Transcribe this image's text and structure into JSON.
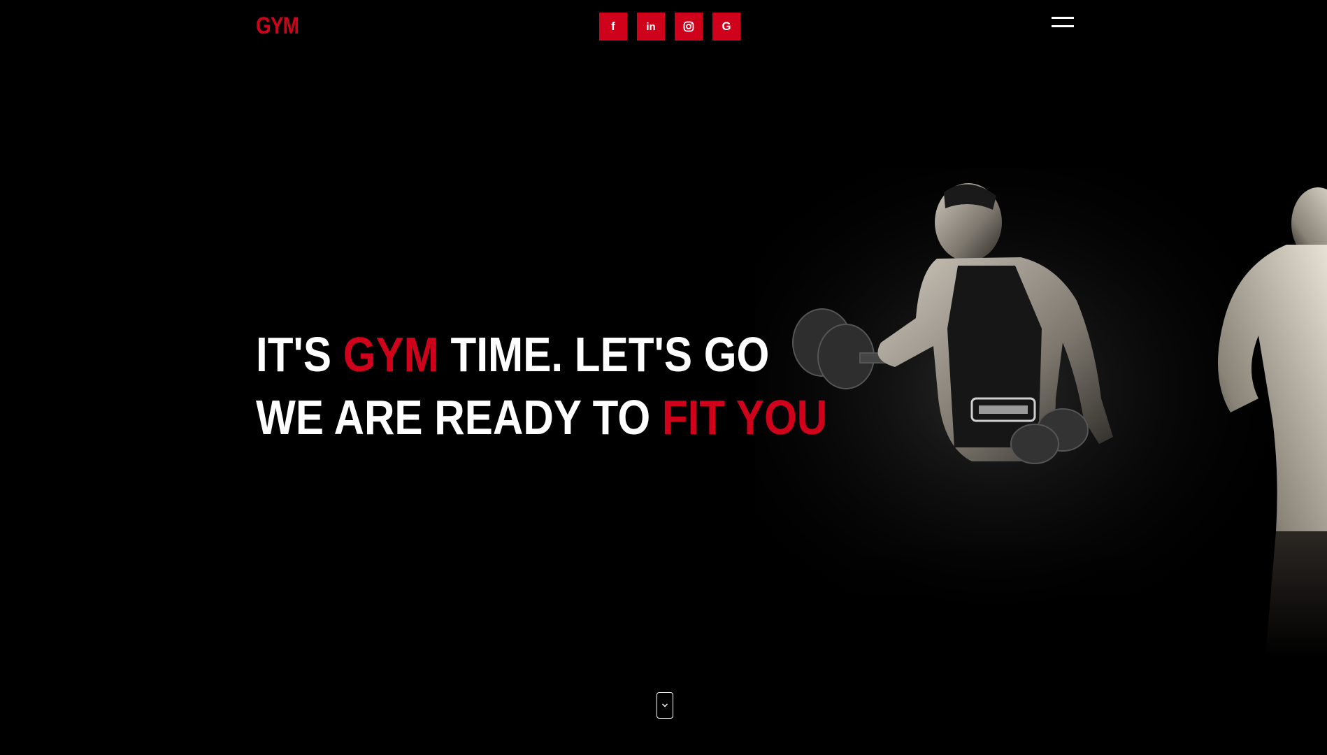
{
  "brand": {
    "logo_text": "GYM"
  },
  "social": [
    {
      "name": "facebook",
      "icon": "facebook-icon",
      "label": "f"
    },
    {
      "name": "linkedin",
      "icon": "linkedin-icon",
      "label": "in"
    },
    {
      "name": "instagram",
      "icon": "instagram-icon",
      "label": ""
    },
    {
      "name": "google",
      "icon": "google-icon",
      "label": "G"
    }
  ],
  "hero": {
    "line1": {
      "part1": "IT'S ",
      "part2": "GYM",
      "part3": " TIME. LET'S GO"
    },
    "line2": {
      "part1": "WE ARE READY TO ",
      "part2": "FIT YOU"
    }
  },
  "colors": {
    "accent": "#d0021b",
    "background": "#000000",
    "text": "#ffffff"
  },
  "icons": {
    "menu": "hamburger-menu-icon",
    "scroll": "chevron-down-icon"
  }
}
